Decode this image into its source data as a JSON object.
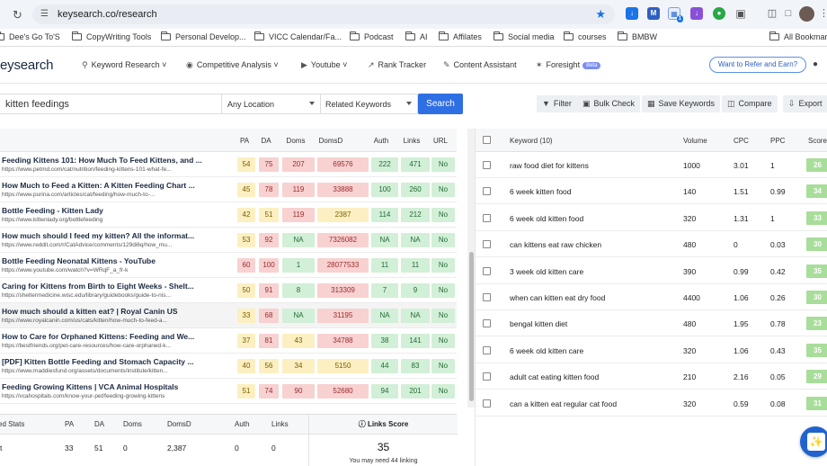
{
  "browser": {
    "url": "keysearch.co/research",
    "bookmarks": [
      "Dee's Go To'S",
      "CopyWriting Tools",
      "Personal Develop...",
      "VICC Calendar/Fa...",
      "Podcast",
      "AI",
      "Affilates",
      "Social media",
      "courses",
      "BMBW",
      "All Bookmarks"
    ],
    "extension_badge": "1"
  },
  "app": {
    "logo": "eysearch",
    "nav": [
      "Keyword Research",
      "Competitive Analysis",
      "Youtube",
      "Rank Tracker",
      "Content Assistant",
      "Foresight"
    ],
    "beta_label": "Beta",
    "refer_label": "Want to Refer and Earn?"
  },
  "search": {
    "keyword": "kitten feedings",
    "location": "Any Location",
    "mode": "Related Keywords",
    "search_label": "Search",
    "tools": [
      "Filter",
      "Bulk Check",
      "Save Keywords",
      "Compare",
      "Export"
    ]
  },
  "serp": {
    "headers": [
      "PA",
      "DA",
      "Doms",
      "DomsD",
      "Auth",
      "Links",
      "URL"
    ],
    "rows": [
      {
        "title": "Feeding Kittens 101: How Much To Feed Kittens, and ...",
        "url": "https://www.petmd.com/cat/nutrition/feeding-kittens-101-what-fe...",
        "pa": "54",
        "da": "75",
        "doms": "207",
        "domsd": "69576",
        "auth": "222",
        "links": "471",
        "urlm": "No",
        "colors": [
          "yel",
          "red",
          "red",
          "red",
          "grn",
          "grn",
          "grn"
        ]
      },
      {
        "title": "How Much to Feed a Kitten: A Kitten Feeding Chart ...",
        "url": "https://www.purina.com/articles/cat/feeding/how-much-to-...",
        "pa": "45",
        "da": "78",
        "doms": "119",
        "domsd": "33888",
        "auth": "100",
        "links": "260",
        "urlm": "No",
        "colors": [
          "yel",
          "red",
          "red",
          "red",
          "grn",
          "grn",
          "grn"
        ]
      },
      {
        "title": "Bottle Feeding - Kitten Lady",
        "url": "https://www.kittenlady.org/bottlefeeding",
        "pa": "42",
        "da": "51",
        "doms": "119",
        "domsd": "2387",
        "auth": "114",
        "links": "212",
        "urlm": "No",
        "colors": [
          "yel",
          "yel",
          "red",
          "yel",
          "grn",
          "grn",
          "grn"
        ]
      },
      {
        "title": "How much should I feed my kitten? All the informat...",
        "url": "https://www.reddit.com/r/CatAdvice/comments/129di6q/how_mu...",
        "pa": "53",
        "da": "92",
        "doms": "NA",
        "domsd": "7326082",
        "auth": "NA",
        "links": "NA",
        "urlm": "No",
        "colors": [
          "yel",
          "red",
          "grn",
          "red",
          "grn",
          "grn",
          "grn"
        ]
      },
      {
        "title": "Bottle Feeding Neonatal Kittens - YouTube",
        "url": "https://www.youtube.com/watch?v=WRqF_a_fr-k",
        "pa": "60",
        "da": "100",
        "doms": "1",
        "domsd": "28077533",
        "auth": "11",
        "links": "11",
        "urlm": "No",
        "colors": [
          "red",
          "red",
          "grn",
          "red",
          "grn",
          "grn",
          "grn"
        ]
      },
      {
        "title": "Caring for Kittens from Birth to Eight Weeks - Shelt...",
        "url": "https://sheltermedicine.wisc.edu/library/guidebooks/guide-to-nis...",
        "pa": "50",
        "da": "91",
        "doms": "8",
        "domsd": "313309",
        "auth": "7",
        "links": "9",
        "urlm": "No",
        "colors": [
          "yel",
          "red",
          "grn",
          "red",
          "grn",
          "grn",
          "grn"
        ]
      },
      {
        "title": "How much should a kitten eat? | Royal Canin US",
        "url": "https://www.royalcanin.com/us/cats/kitten/how-much-to-feed-a...",
        "pa": "33",
        "da": "68",
        "doms": "NA",
        "domsd": "31195",
        "auth": "NA",
        "links": "NA",
        "urlm": "No",
        "colors": [
          "yel",
          "red",
          "grn",
          "red",
          "grn",
          "grn",
          "grn"
        ]
      },
      {
        "title": "How to Care for Orphaned Kittens: Feeding and We...",
        "url": "https://bestfriends.org/pet-care-resources/how-care-orphaned-k...",
        "pa": "37",
        "da": "81",
        "doms": "43",
        "domsd": "34788",
        "auth": "38",
        "links": "141",
        "urlm": "No",
        "colors": [
          "yel",
          "red",
          "yel",
          "red",
          "grn",
          "grn",
          "grn"
        ]
      },
      {
        "title": "[PDF] Kitten Bottle Feeding and Stomach Capacity ...",
        "url": "https://www.maddiesfund.org/assets/documents/institute/kitten...",
        "pa": "40",
        "da": "56",
        "doms": "34",
        "domsd": "5150",
        "auth": "44",
        "links": "83",
        "urlm": "No",
        "colors": [
          "yel",
          "yel",
          "yel",
          "yel",
          "grn",
          "grn",
          "grn"
        ]
      },
      {
        "title": "Feeding Growing Kittens | VCA Animal Hospitals",
        "url": "https://vcahospitals.com/know-your-pet/feeding-growing-kittens",
        "pa": "51",
        "da": "74",
        "doms": "90",
        "domsd": "52680",
        "auth": "94",
        "links": "201",
        "urlm": "No",
        "colors": [
          "yel",
          "red",
          "red",
          "red",
          "grn",
          "grn",
          "grn"
        ]
      }
    ]
  },
  "stats": {
    "headers": [
      "ed Stats",
      "PA",
      "DA",
      "Doms",
      "DomsD",
      "Auth",
      "Links"
    ],
    "values": [
      "t",
      "33",
      "51",
      "0",
      "2,387",
      "0",
      "0"
    ],
    "links_score_label": "Links Score",
    "links_score": "35",
    "links_note": "You may need 44 linking"
  },
  "keywords": {
    "headers": [
      "Keyword (10)",
      "Volume",
      "CPC",
      "PPC",
      "Score"
    ],
    "rows": [
      {
        "kw": "raw food diet for kittens",
        "vol": "1000",
        "cpc": "3.01",
        "ppc": "1",
        "score": "26"
      },
      {
        "kw": "6 week kitten food",
        "vol": "140",
        "cpc": "1.51",
        "ppc": "0.99",
        "score": "34"
      },
      {
        "kw": "6 week old kitten food",
        "vol": "320",
        "cpc": "1.31",
        "ppc": "1",
        "score": "33"
      },
      {
        "kw": "can kittens eat raw chicken",
        "vol": "480",
        "cpc": "0",
        "ppc": "0.03",
        "score": "30"
      },
      {
        "kw": "3 week old kitten care",
        "vol": "390",
        "cpc": "0.99",
        "ppc": "0.42",
        "score": "35"
      },
      {
        "kw": "when can kitten eat dry food",
        "vol": "4400",
        "cpc": "1.06",
        "ppc": "0.26",
        "score": "30"
      },
      {
        "kw": "bengal kitten diet",
        "vol": "480",
        "cpc": "1.95",
        "ppc": "0.78",
        "score": "23"
      },
      {
        "kw": "6 week old kitten care",
        "vol": "320",
        "cpc": "1.06",
        "ppc": "0.43",
        "score": "35"
      },
      {
        "kw": "adult cat eating kitten food",
        "vol": "210",
        "cpc": "2.16",
        "ppc": "0.05",
        "score": "29"
      },
      {
        "kw": "can a kitten eat regular cat food",
        "vol": "320",
        "cpc": "0.59",
        "ppc": "0.08",
        "score": "31"
      }
    ]
  },
  "colors": {
    "accent": "#2f6fe4",
    "score_green": "#a8dd9a",
    "cell_red": "#f8d1d1",
    "cell_yellow": "#fcefc1",
    "cell_green": "#d2efd7"
  },
  "icons": [
    "reload-icon",
    "site-settings-icon",
    "bookmark-star-icon",
    "folder-icon",
    "search-icon",
    "globe-icon",
    "youtube-icon",
    "trend-icon",
    "pen-icon",
    "sparkle-icon",
    "filter-icon",
    "trash-icon",
    "save-icon",
    "compare-icon",
    "export-icon",
    "info-icon",
    "pdf-icon",
    "user-icon"
  ]
}
